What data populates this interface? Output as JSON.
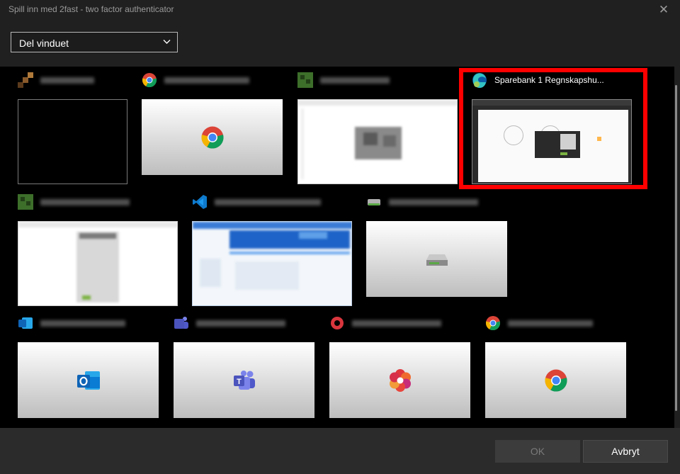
{
  "window": {
    "title": "Spill inn med 2fast - two factor authenticator"
  },
  "dropdown": {
    "selected": "Del vinduet"
  },
  "selected_tile": {
    "title": "Sparebank 1 Regnskapshu..."
  },
  "buttons": {
    "ok": "OK",
    "cancel": "Avbryt"
  },
  "tiles": [
    {
      "app_icon": "minecraft-icon",
      "thumb_icon": "none"
    },
    {
      "app_icon": "chrome-icon",
      "thumb_icon": "chrome-icon"
    },
    {
      "app_icon": "minecraft-icon",
      "thumb_icon": "none"
    },
    {
      "app_icon": "edge-icon",
      "thumb_icon": "none"
    },
    {
      "app_icon": "minecraft-icon",
      "thumb_icon": "none"
    },
    {
      "app_icon": "vscode-icon",
      "thumb_icon": "none"
    },
    {
      "app_icon": "drive-icon",
      "thumb_icon": "drive-icon"
    },
    {
      "app_icon": "outlook-icon",
      "thumb_icon": "outlook-icon"
    },
    {
      "app_icon": "teams-icon",
      "thumb_icon": "teams-icon"
    },
    {
      "app_icon": "office-icon",
      "thumb_icon": "office-icon"
    },
    {
      "app_icon": "chrome-icon",
      "thumb_icon": "chrome-icon"
    }
  ],
  "colors": {
    "selection_border": "#ff0000",
    "background": "#202020",
    "grid_background": "#000000"
  }
}
